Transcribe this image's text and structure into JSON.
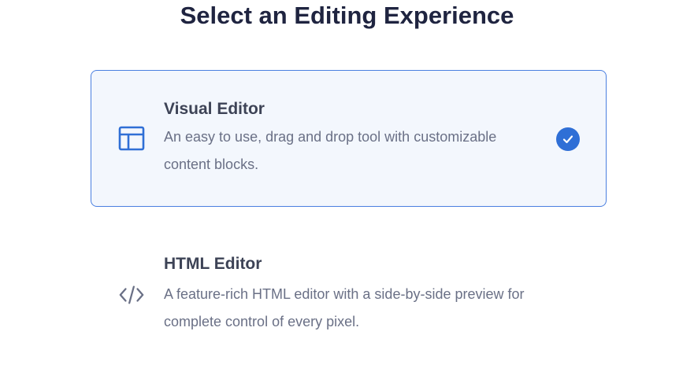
{
  "page": {
    "title": "Select an Editing Experience"
  },
  "options": [
    {
      "title": "Visual Editor",
      "description": "An easy to use, drag and drop tool with customizable content blocks.",
      "icon": "layout-icon",
      "selected": true
    },
    {
      "title": "HTML Editor",
      "description": "A feature-rich HTML editor with a side-by-side preview for complete control of every pixel.",
      "icon": "code-icon",
      "selected": false
    }
  ],
  "colors": {
    "accent": "#2f6fd6",
    "selected_border": "#4a7fe0",
    "selected_bg": "#f3f7fd",
    "title_text": "#1f2440",
    "body_text": "#6a7086"
  }
}
